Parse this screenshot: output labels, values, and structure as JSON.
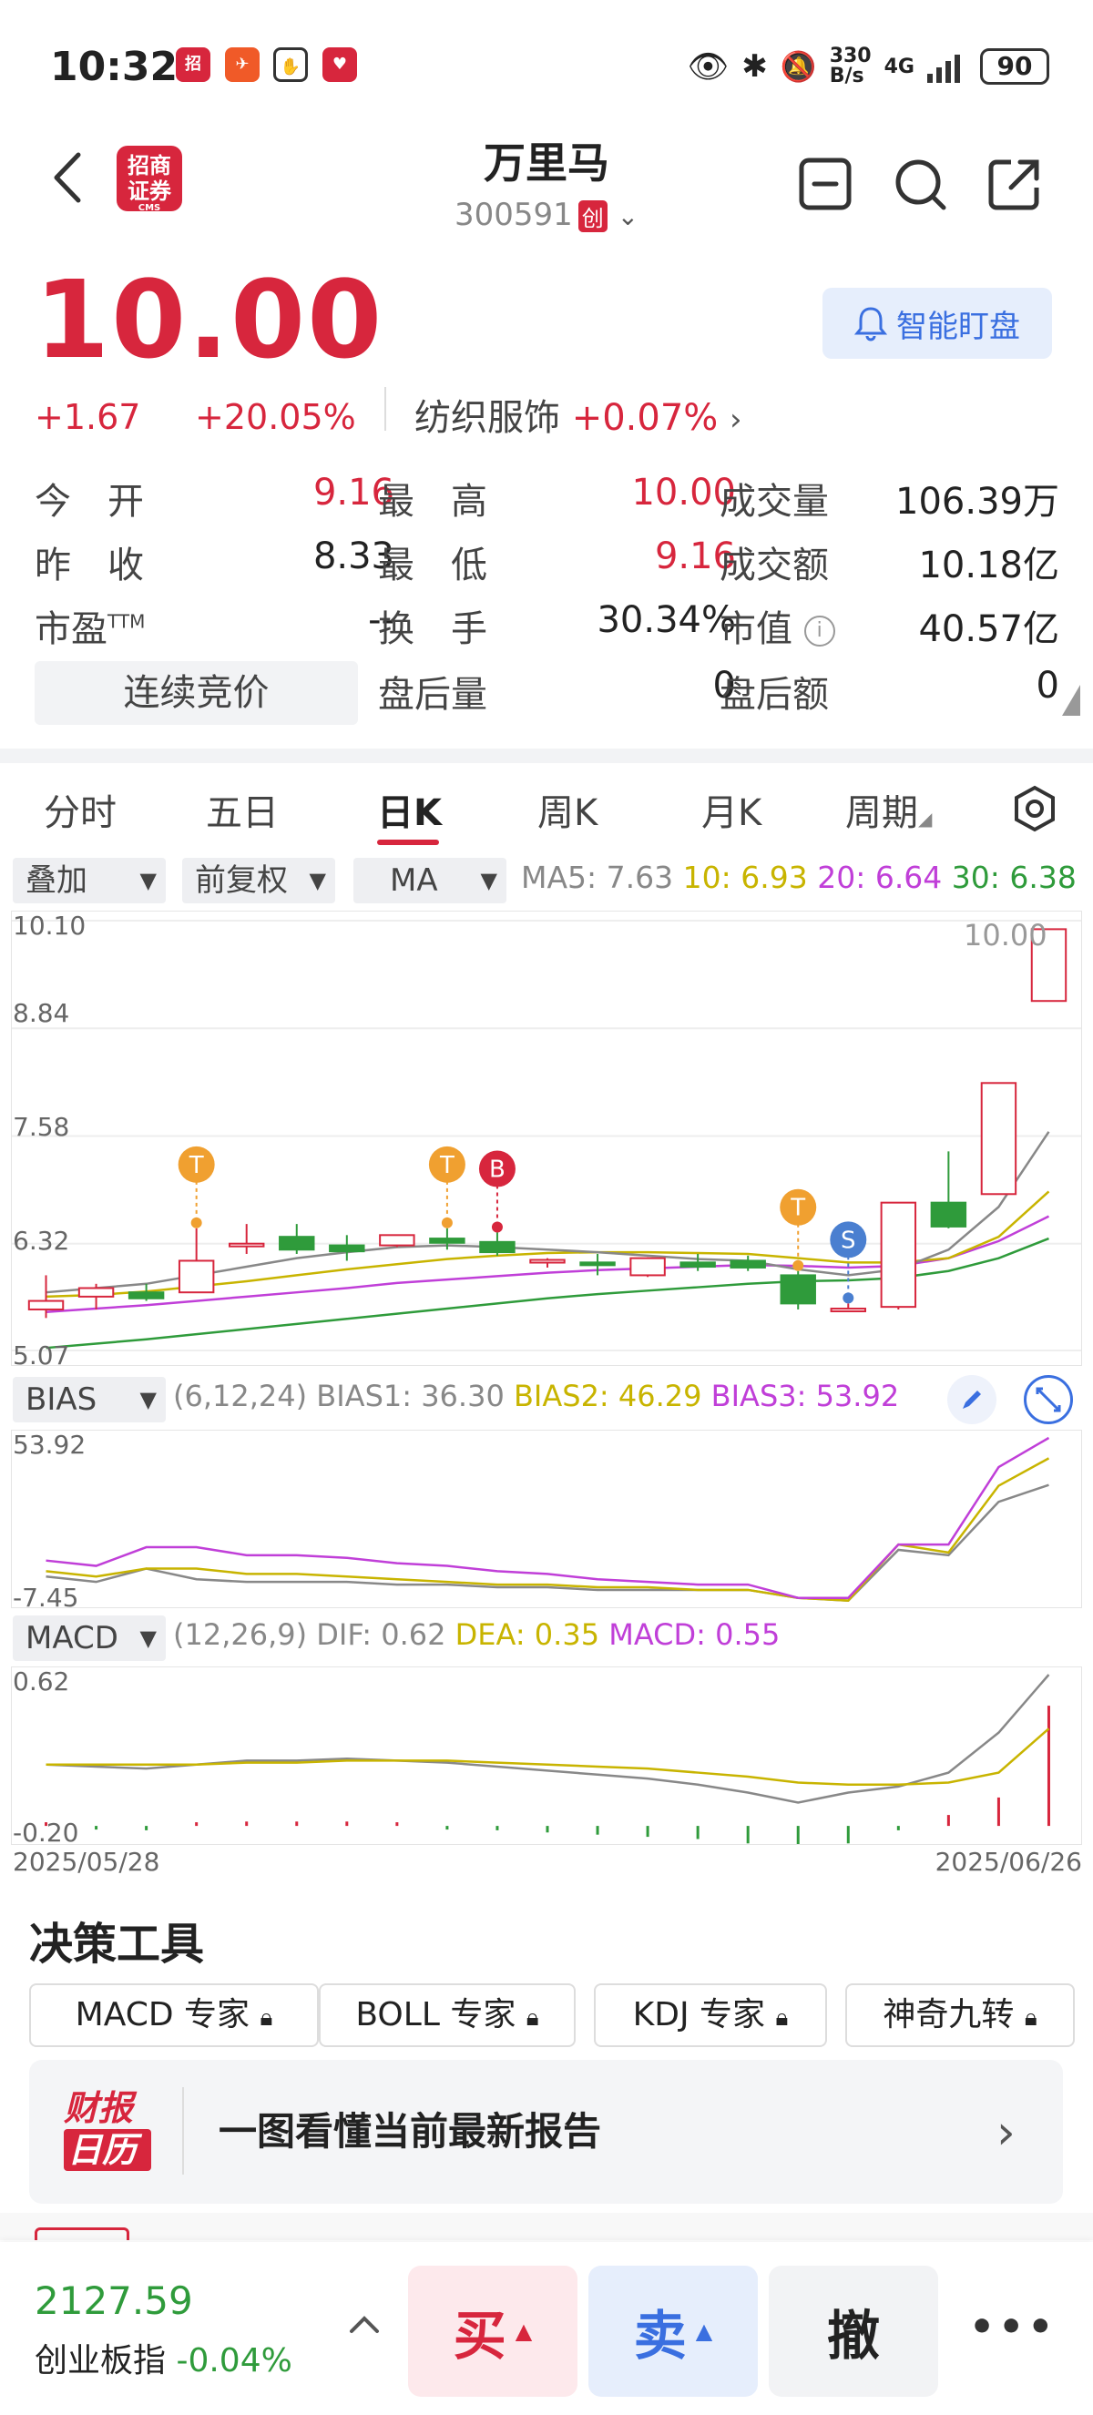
{
  "status_bar": {
    "time": "10:32",
    "net_speed_top": "330",
    "net_speed_bottom": "B/s",
    "network": "4G",
    "battery": "90",
    "icons": [
      "eye-icon",
      "bluetooth-icon",
      "mute-bell-icon",
      "signal-icon"
    ]
  },
  "header": {
    "logo_line1": "招商",
    "logo_line2": "证券",
    "logo_sub": "CMS",
    "stock_name": "万里马",
    "stock_code": "300591",
    "board_tag": "创"
  },
  "quote": {
    "price": "10.00",
    "change": "+1.67",
    "change_pct": "+20.05%",
    "sector_name": "纺织服饰",
    "sector_change": "+0.07%",
    "watch_label": "智能盯盘",
    "colors": {
      "up": "#d7263d",
      "down": "#2f9b3b"
    }
  },
  "stats": {
    "open_label": "今　开",
    "open_value": "9.16",
    "high_label": "最　高",
    "high_value": "10.00",
    "volume_label": "成交量",
    "volume_value": "106.39万",
    "prev_close_label": "昨　收",
    "prev_close_value": "8.33",
    "low_label": "最　低",
    "low_value": "9.16",
    "amount_label": "成交额",
    "amount_value": "10.18亿",
    "pe_label": "市盈",
    "pe_sup": "TTM",
    "pe_value": "--",
    "turnover_label": "换　手",
    "turnover_value": "30.34%",
    "mktcap_label": "市值",
    "mktcap_value": "40.57亿",
    "auction_label": "连续竞价",
    "after_vol_label": "盘后量",
    "after_vol_value": "0",
    "after_amt_label": "盘后额",
    "after_amt_value": "0"
  },
  "tabs": [
    {
      "label": "分时"
    },
    {
      "label": "五日"
    },
    {
      "label": "日K"
    },
    {
      "label": "周K"
    },
    {
      "label": "月K"
    },
    {
      "label": "周期"
    }
  ],
  "active_tab": "日K",
  "chart_controls": {
    "overlay_label": "叠加",
    "adjust_label": "前复权",
    "indicator_label": "MA",
    "ma5": "MA5: 7.63",
    "ma10": "10: 6.93",
    "ma20": "20: 6.64",
    "ma30": "30: 6.38",
    "ma_colors": {
      "ma5": "#888888",
      "ma10": "#c8b400",
      "ma20": "#c03fd8",
      "ma30": "#2f9b3b"
    }
  },
  "kline_axis": {
    "y_labels": [
      "10.10",
      "8.84",
      "7.58",
      "6.32",
      "5.07"
    ],
    "latest_label": "10.00",
    "date_start": "2025/05/28",
    "date_end": "2025/06/26"
  },
  "kline_markers": [
    {
      "letter": "T",
      "color": "#f0a030"
    },
    {
      "letter": "T",
      "color": "#f0a030"
    },
    {
      "letter": "B",
      "color": "#d7263d"
    },
    {
      "letter": "T",
      "color": "#f0a030"
    },
    {
      "letter": "S",
      "color": "#4a7fd0"
    }
  ],
  "bias": {
    "label": "BIAS",
    "params": "(6,12,24)",
    "bias1": "BIAS1: 36.30",
    "bias2": "BIAS2: 46.29",
    "bias3": "BIAS3: 53.92",
    "y_top": "53.92",
    "y_bottom": "-7.45"
  },
  "macd": {
    "label": "MACD",
    "params": "(12,26,9)",
    "dif": "DIF: 0.62",
    "dea": "DEA: 0.35",
    "macd": "MACD: 0.55",
    "y_top": "0.62",
    "y_bottom": "-0.20"
  },
  "chart_data": [
    {
      "type": "candlestick",
      "title": "",
      "ylim": [
        5.07,
        10.1
      ],
      "candles": [
        {
          "o": 5.55,
          "h": 5.95,
          "l": 5.45,
          "c": 5.65
        },
        {
          "o": 5.7,
          "h": 5.85,
          "l": 5.55,
          "c": 5.8
        },
        {
          "o": 5.75,
          "h": 5.85,
          "l": 5.65,
          "c": 5.68
        },
        {
          "o": 5.75,
          "h": 6.5,
          "l": 5.75,
          "c": 6.12
        },
        {
          "o": 6.32,
          "h": 6.55,
          "l": 6.2,
          "c": 6.32
        },
        {
          "o": 6.4,
          "h": 6.55,
          "l": 6.2,
          "c": 6.25
        },
        {
          "o": 6.3,
          "h": 6.42,
          "l": 6.12,
          "c": 6.23
        },
        {
          "o": 6.3,
          "h": 6.42,
          "l": 6.28,
          "c": 6.42
        },
        {
          "o": 6.38,
          "h": 6.5,
          "l": 6.25,
          "c": 6.33
        },
        {
          "o": 6.34,
          "h": 6.45,
          "l": 6.18,
          "c": 6.22
        },
        {
          "o": 6.1,
          "h": 6.15,
          "l": 6.04,
          "c": 6.13
        },
        {
          "o": 6.1,
          "h": 6.2,
          "l": 5.95,
          "c": 6.08
        },
        {
          "o": 5.95,
          "h": 6.16,
          "l": 5.93,
          "c": 6.15
        },
        {
          "o": 6.1,
          "h": 6.2,
          "l": 6.0,
          "c": 6.05
        },
        {
          "o": 6.12,
          "h": 6.18,
          "l": 6.0,
          "c": 6.04
        },
        {
          "o": 5.95,
          "h": 6.0,
          "l": 5.55,
          "c": 5.62
        },
        {
          "o": 5.55,
          "h": 5.62,
          "l": 5.52,
          "c": 5.56
        },
        {
          "o": 5.58,
          "h": 6.8,
          "l": 5.55,
          "c": 6.8
        },
        {
          "o": 6.8,
          "h": 7.4,
          "l": 6.5,
          "c": 6.52
        },
        {
          "o": 6.9,
          "h": 8.2,
          "l": 6.9,
          "c": 8.2
        },
        {
          "o": 9.16,
          "h": 10.0,
          "l": 9.16,
          "c": 10.0
        }
      ],
      "ma5": [
        5.75,
        5.8,
        5.85,
        5.95,
        6.05,
        6.15,
        6.22,
        6.28,
        6.3,
        6.28,
        6.25,
        6.22,
        6.18,
        6.14,
        6.12,
        6.02,
        5.95,
        6.02,
        6.25,
        6.75,
        7.63
      ],
      "ma10": [
        5.7,
        5.72,
        5.76,
        5.82,
        5.88,
        5.95,
        6.02,
        6.08,
        6.14,
        6.18,
        6.21,
        6.22,
        6.22,
        6.21,
        6.2,
        6.15,
        6.1,
        6.1,
        6.15,
        6.4,
        6.93
      ],
      "ma20": [
        5.52,
        5.56,
        5.6,
        5.65,
        5.7,
        5.75,
        5.8,
        5.86,
        5.9,
        5.94,
        5.98,
        6.01,
        6.03,
        6.05,
        6.07,
        6.06,
        6.04,
        6.06,
        6.15,
        6.35,
        6.64
      ],
      "ma30": [
        5.1,
        5.15,
        5.2,
        5.26,
        5.32,
        5.38,
        5.44,
        5.5,
        5.56,
        5.62,
        5.68,
        5.73,
        5.77,
        5.81,
        5.85,
        5.88,
        5.89,
        5.92,
        6.0,
        6.15,
        6.38
      ]
    },
    {
      "type": "line",
      "title": "BIAS",
      "ylim": [
        -7.45,
        53.92
      ],
      "series": [
        {
          "name": "BIAS1",
          "values": [
            2,
            0,
            5,
            1,
            0,
            0,
            0,
            -1,
            -1,
            -2,
            -2,
            -3,
            -3,
            -3,
            -3,
            -6,
            -7,
            12,
            10,
            30,
            36.3
          ]
        },
        {
          "name": "BIAS2",
          "values": [
            4,
            2,
            5,
            5,
            3,
            3,
            2,
            1,
            0,
            -1,
            -1,
            -2,
            -2,
            -3,
            -3,
            -6,
            -7,
            14,
            11,
            36,
            46.29
          ]
        },
        {
          "name": "BIAS3",
          "values": [
            8,
            6,
            13,
            13,
            10,
            10,
            9,
            7,
            6,
            4,
            3,
            1,
            0,
            -1,
            -1,
            -6,
            -6,
            14,
            14,
            43,
            53.92
          ]
        }
      ]
    },
    {
      "type": "bar",
      "title": "MACD",
      "ylim": [
        -0.2,
        0.62
      ],
      "dif": [
        0.17,
        0.16,
        0.15,
        0.17,
        0.19,
        0.19,
        0.2,
        0.19,
        0.18,
        0.16,
        0.14,
        0.12,
        0.1,
        0.07,
        0.03,
        -0.02,
        0.03,
        0.06,
        0.13,
        0.33,
        0.62
      ],
      "dea": [
        0.17,
        0.17,
        0.17,
        0.17,
        0.18,
        0.18,
        0.19,
        0.19,
        0.19,
        0.18,
        0.17,
        0.16,
        0.15,
        0.13,
        0.11,
        0.08,
        0.07,
        0.07,
        0.08,
        0.13,
        0.35
      ],
      "macd": [
        0.0,
        -0.01,
        -0.02,
        0.0,
        0.02,
        0.02,
        0.02,
        0.0,
        -0.01,
        -0.02,
        -0.03,
        -0.04,
        -0.05,
        -0.06,
        -0.08,
        -0.1,
        -0.08,
        -0.02,
        0.05,
        0.13,
        0.55
      ]
    }
  ],
  "tools": {
    "title": "决策工具",
    "buttons": [
      {
        "label": "MACD 专家"
      },
      {
        "label": "BOLL 专家"
      },
      {
        "label": "KDJ 专家"
      },
      {
        "label": "神奇九转"
      }
    ]
  },
  "report": {
    "icon_line1": "财报",
    "icon_line2": "日历",
    "text": "一图看懂当前最新报告"
  },
  "bottom": {
    "index_value": "2127.59",
    "index_name": "创业板指",
    "index_change": "-0.04%",
    "buy_label": "买",
    "sell_label": "卖",
    "cancel_label": "撤",
    "more_label": "•••"
  }
}
